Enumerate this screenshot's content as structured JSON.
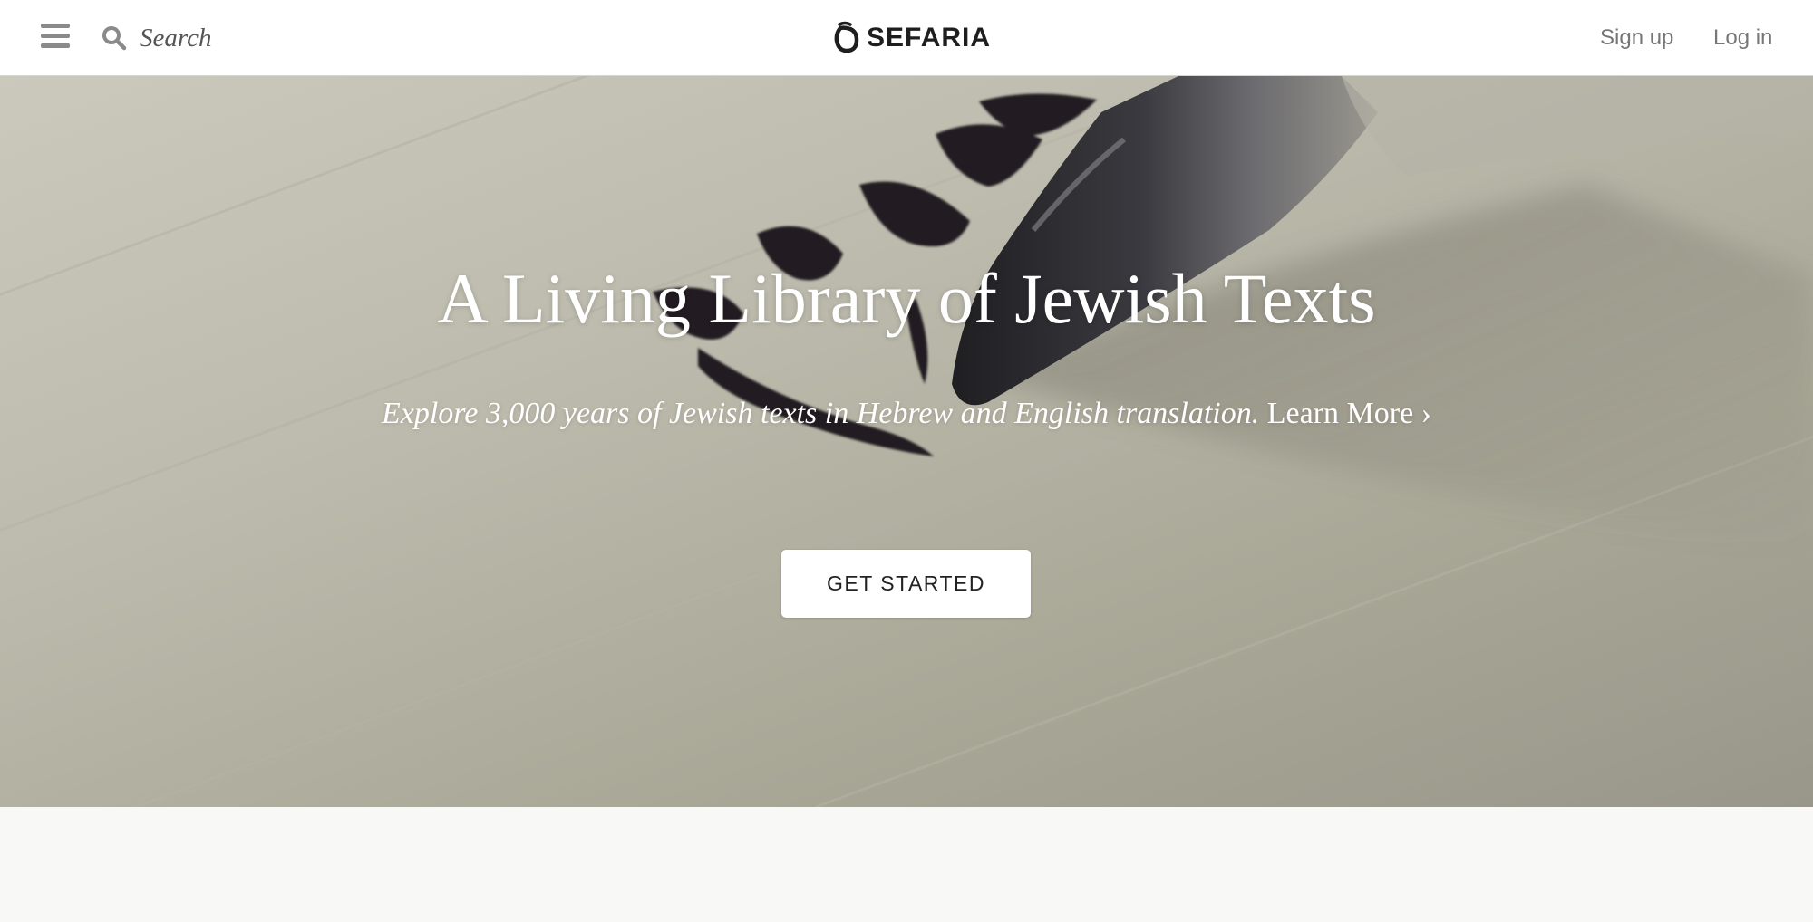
{
  "header": {
    "search_placeholder": "Search",
    "logo_text": "SEFARIA",
    "signup_label": "Sign up",
    "login_label": "Log in",
    "icons": {
      "menu": "hamburger-menu-icon",
      "search": "search-icon",
      "logo": "sefaria-logo-icon"
    }
  },
  "hero": {
    "title": "A Living Library of Jewish Texts",
    "tagline": "Explore 3,000 years of Jewish texts in Hebrew and English translation.",
    "learn_more": "Learn More ›",
    "cta_label": "GET STARTED",
    "background_description_icon": "calligraphy-pen-image"
  },
  "colors": {
    "header_bg": "#ffffff",
    "header_text": "#777777",
    "logo_text": "#1e1e1e",
    "hero_text": "#ffffff",
    "cta_bg": "#ffffff",
    "cta_text": "#222222",
    "page_bg": "#f8f8f6"
  }
}
